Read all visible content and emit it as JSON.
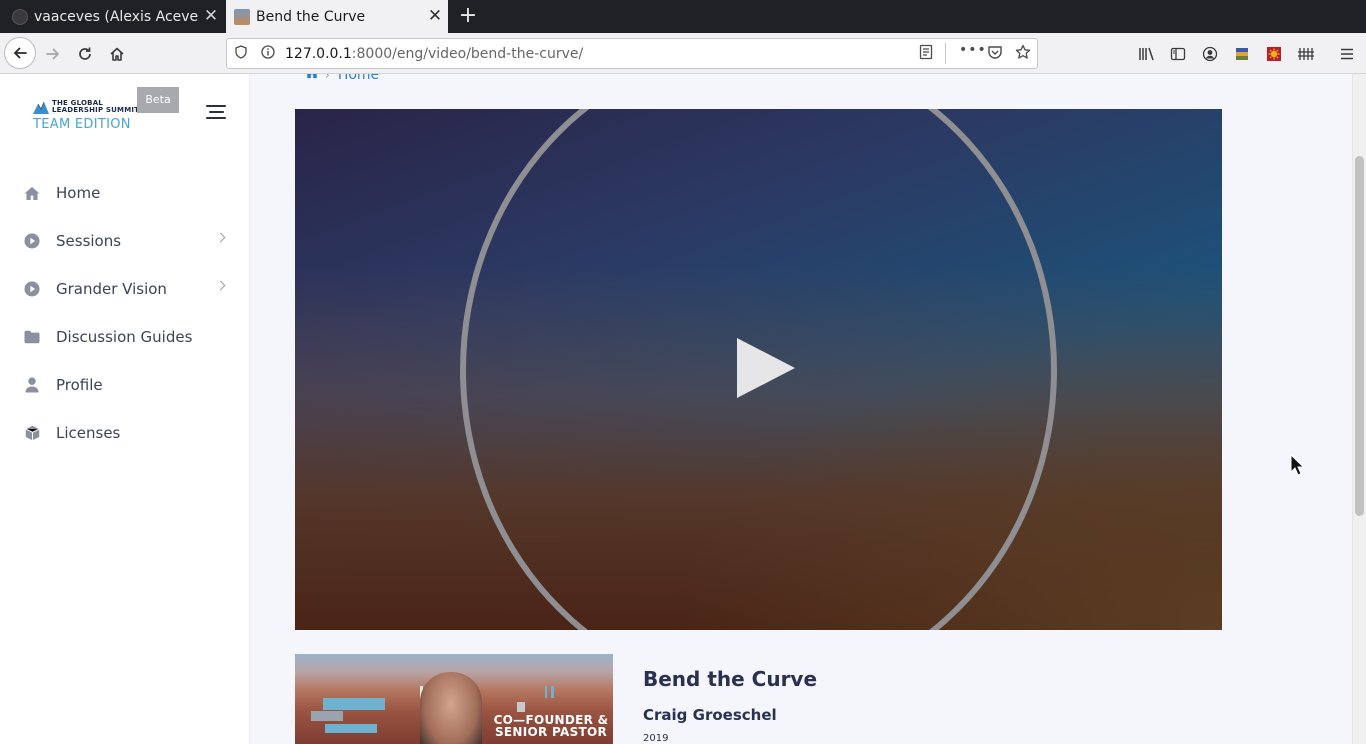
{
  "browser": {
    "tabs": [
      {
        "label": "vaaceves (Alexis Aceves)",
        "active": false
      },
      {
        "label": "Bend the Curve",
        "active": true
      }
    ],
    "new_tab": "+",
    "close_glyph": "✕",
    "url": {
      "host": "127.0.0.1",
      "rest": ":8000/eng/video/bend-the-curve/"
    },
    "url_menu_glyph": "•••"
  },
  "sidebar": {
    "logo": {
      "line1": "THE GLOBAL",
      "line2": "LEADERSHIP SUMMIT",
      "line3": "TEAM EDITION"
    },
    "beta_label": "Beta",
    "items": [
      {
        "label": "Home",
        "icon": "home-icon",
        "has_submenu": false
      },
      {
        "label": "Sessions",
        "icon": "play-circle-icon",
        "has_submenu": true
      },
      {
        "label": "Grander Vision",
        "icon": "play-circle-icon",
        "has_submenu": true
      },
      {
        "label": "Discussion Guides",
        "icon": "folder-icon",
        "has_submenu": false
      },
      {
        "label": "Profile",
        "icon": "user-icon",
        "has_submenu": false
      },
      {
        "label": "Licenses",
        "icon": "box-icon",
        "has_submenu": false
      }
    ]
  },
  "main": {
    "breadcrumb": {
      "sep": "›",
      "current": "Home"
    },
    "video": {
      "state": "paused"
    },
    "thumbnail_caption": {
      "line1": "CO—FOUNDER &",
      "line2": "SENIOR PASTOR"
    },
    "session": {
      "title": "Bend the Curve",
      "speaker": "Craig Groeschel",
      "year": "2019"
    }
  },
  "colors": {
    "accent": "#2f7fd0",
    "logo_blue": "#4aa3d6",
    "text_dark": "#2a3150"
  }
}
